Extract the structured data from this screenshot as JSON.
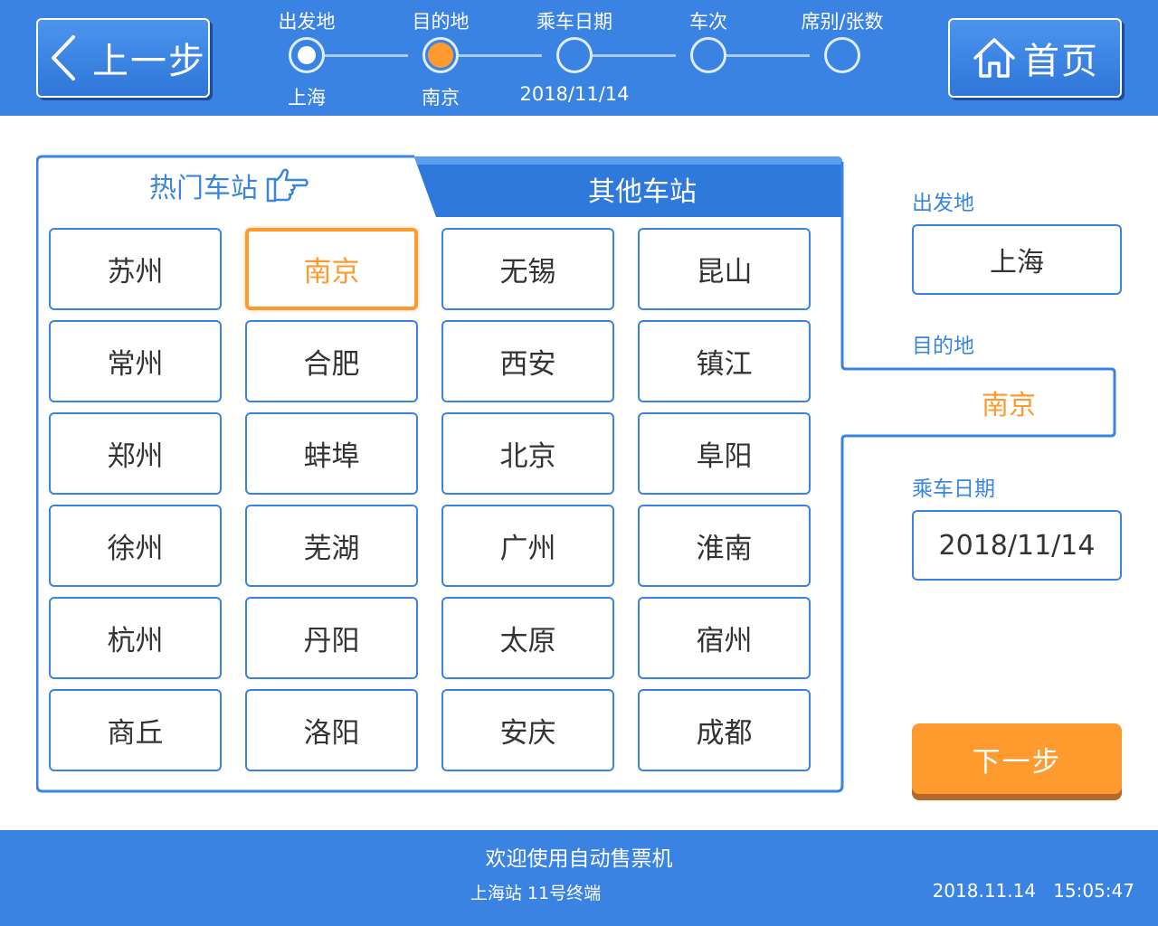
{
  "header": {
    "back_label": "上一步",
    "home_label": "首页",
    "steps": [
      {
        "title": "出发地",
        "value": "上海",
        "state": "done"
      },
      {
        "title": "目的地",
        "value": "南京",
        "state": "active"
      },
      {
        "title": "乘车日期",
        "value": "2018/11/14",
        "state": "pending"
      },
      {
        "title": "车次",
        "value": "",
        "state": "pending"
      },
      {
        "title": "席别/张数",
        "value": "",
        "state": "pending"
      }
    ]
  },
  "tabs": {
    "hot_label": "热门车站",
    "other_label": "其他车站",
    "active": "hot"
  },
  "stations": [
    "苏州",
    "南京",
    "无锡",
    "昆山",
    "常州",
    "合肥",
    "西安",
    "镇江",
    "郑州",
    "蚌埠",
    "北京",
    "阜阳",
    "徐州",
    "芜湖",
    "广州",
    "淮南",
    "杭州",
    "丹阳",
    "太原",
    "宿州",
    "商丘",
    "洛阳",
    "安庆",
    "成都"
  ],
  "selected_station": "南京",
  "summary": {
    "departure_label": "出发地",
    "departure_value": "上海",
    "destination_label": "目的地",
    "destination_value": "南京",
    "date_label": "乘车日期",
    "date_value": "2018/11/14"
  },
  "next_label": "下一步",
  "footer": {
    "welcome": "欢迎使用自动售票机",
    "terminal": "上海站 11号终端",
    "date": "2018.11.14",
    "time": "15:05:47"
  },
  "colors": {
    "primary": "#3a83e2",
    "accent": "#ff9a2e",
    "label": "#3a86db"
  }
}
